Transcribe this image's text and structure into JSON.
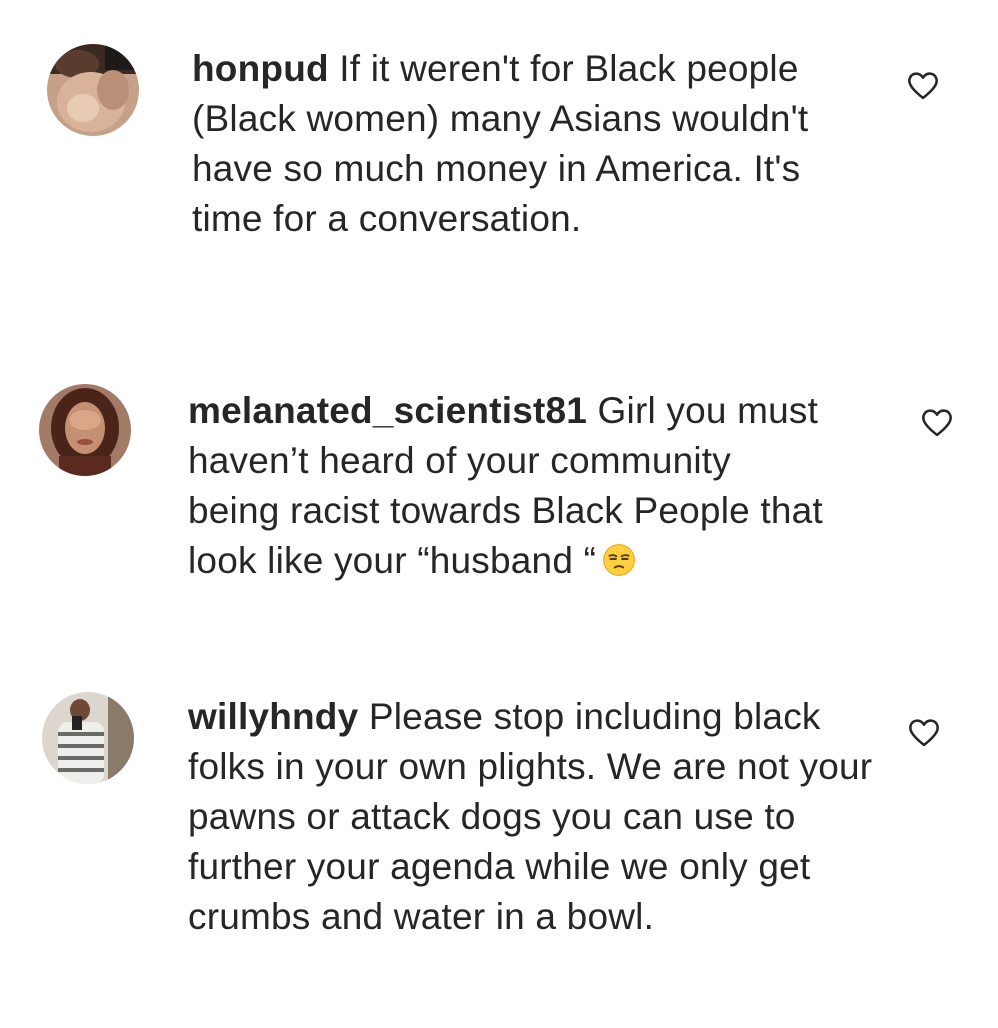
{
  "comments": [
    {
      "username": "honpud",
      "text": " If it weren't for Black people (Black women) many Asians wouldn't have so much money in America. It's time for a conversation.",
      "avatar_icon": "profile-photo",
      "like_icon": "heart-outline-icon"
    },
    {
      "username": "melanated_scientist81",
      "text": " Girl you must haven’t heard of your community being racist towards Black People that look like your “husband “",
      "emoji": "unamused-face-emoji",
      "avatar_icon": "profile-photo",
      "like_icon": "heart-outline-icon"
    },
    {
      "username": "willyhndy",
      "text": " Please stop including black folks in your own plights. We are not your pawns or attack dogs you can use to further your agenda while we only get crumbs and water in a bowl.",
      "avatar_icon": "profile-photo",
      "like_icon": "heart-outline-icon"
    }
  ],
  "colors": {
    "text": "#262626",
    "icon_stroke": "#262626",
    "background": "#ffffff"
  }
}
